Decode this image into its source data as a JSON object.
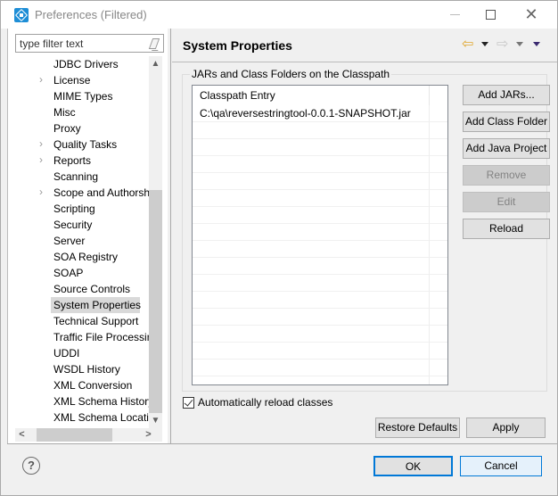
{
  "window": {
    "title": "Preferences (Filtered)",
    "controls": {
      "minimize": "minimize",
      "maximize": "maximize",
      "close": "✕"
    }
  },
  "filter": {
    "placeholder": "type filter text",
    "value": ""
  },
  "tree": {
    "items": [
      {
        "label": "JDBC Drivers",
        "expandable": false
      },
      {
        "label": "License",
        "expandable": true
      },
      {
        "label": "MIME Types",
        "expandable": false
      },
      {
        "label": "Misc",
        "expandable": false
      },
      {
        "label": "Proxy",
        "expandable": false
      },
      {
        "label": "Quality Tasks",
        "expandable": true
      },
      {
        "label": "Reports",
        "expandable": true
      },
      {
        "label": "Scanning",
        "expandable": false
      },
      {
        "label": "Scope and Authorsh",
        "expandable": true
      },
      {
        "label": "Scripting",
        "expandable": false
      },
      {
        "label": "Security",
        "expandable": false
      },
      {
        "label": "Server",
        "expandable": false
      },
      {
        "label": "SOA Registry",
        "expandable": false
      },
      {
        "label": "SOAP",
        "expandable": false
      },
      {
        "label": "Source Controls",
        "expandable": false
      },
      {
        "label": "System Properties",
        "expandable": false,
        "selected": true
      },
      {
        "label": "Technical Support",
        "expandable": false
      },
      {
        "label": "Traffic File Processin",
        "expandable": false
      },
      {
        "label": "UDDI",
        "expandable": false
      },
      {
        "label": "WSDL History",
        "expandable": false
      },
      {
        "label": "XML Conversion",
        "expandable": false
      },
      {
        "label": "XML Schema History",
        "expandable": false
      },
      {
        "label": "XML Schema Locati",
        "expandable": false
      }
    ],
    "expander_glyph": "›",
    "scroll_up": "⌃",
    "scroll_down": "⌄",
    "scroll_left": "<",
    "scroll_right": ">"
  },
  "page": {
    "title": "System Properties",
    "nav": {
      "back": "⇦",
      "forward": "⇨"
    },
    "group_label": "JARs and Class Folders on the Classpath",
    "table": {
      "column": "Classpath Entry",
      "rows": [
        "C:\\qa\\reversestringtool-0.0.1-SNAPSHOT.jar",
        "",
        "",
        "",
        "",
        "",
        "",
        "",
        "",
        "",
        "",
        "",
        "",
        "",
        "",
        ""
      ]
    },
    "buttons": {
      "add_jars": "Add JARs...",
      "add_class_folder": "Add Class Folder",
      "add_java_project": "Add Java Project",
      "remove": "Remove",
      "edit": "Edit",
      "reload": "Reload"
    },
    "auto_reload": {
      "label": "Automatically reload classes",
      "checked": true
    },
    "restore_defaults": "Restore Defaults",
    "apply": "Apply"
  },
  "footer": {
    "help": "?",
    "ok": "OK",
    "cancel": "Cancel"
  },
  "colors": {
    "accent": "#0078d7",
    "selection": "#d9d9d9",
    "back_arrow": "#e0a830"
  }
}
